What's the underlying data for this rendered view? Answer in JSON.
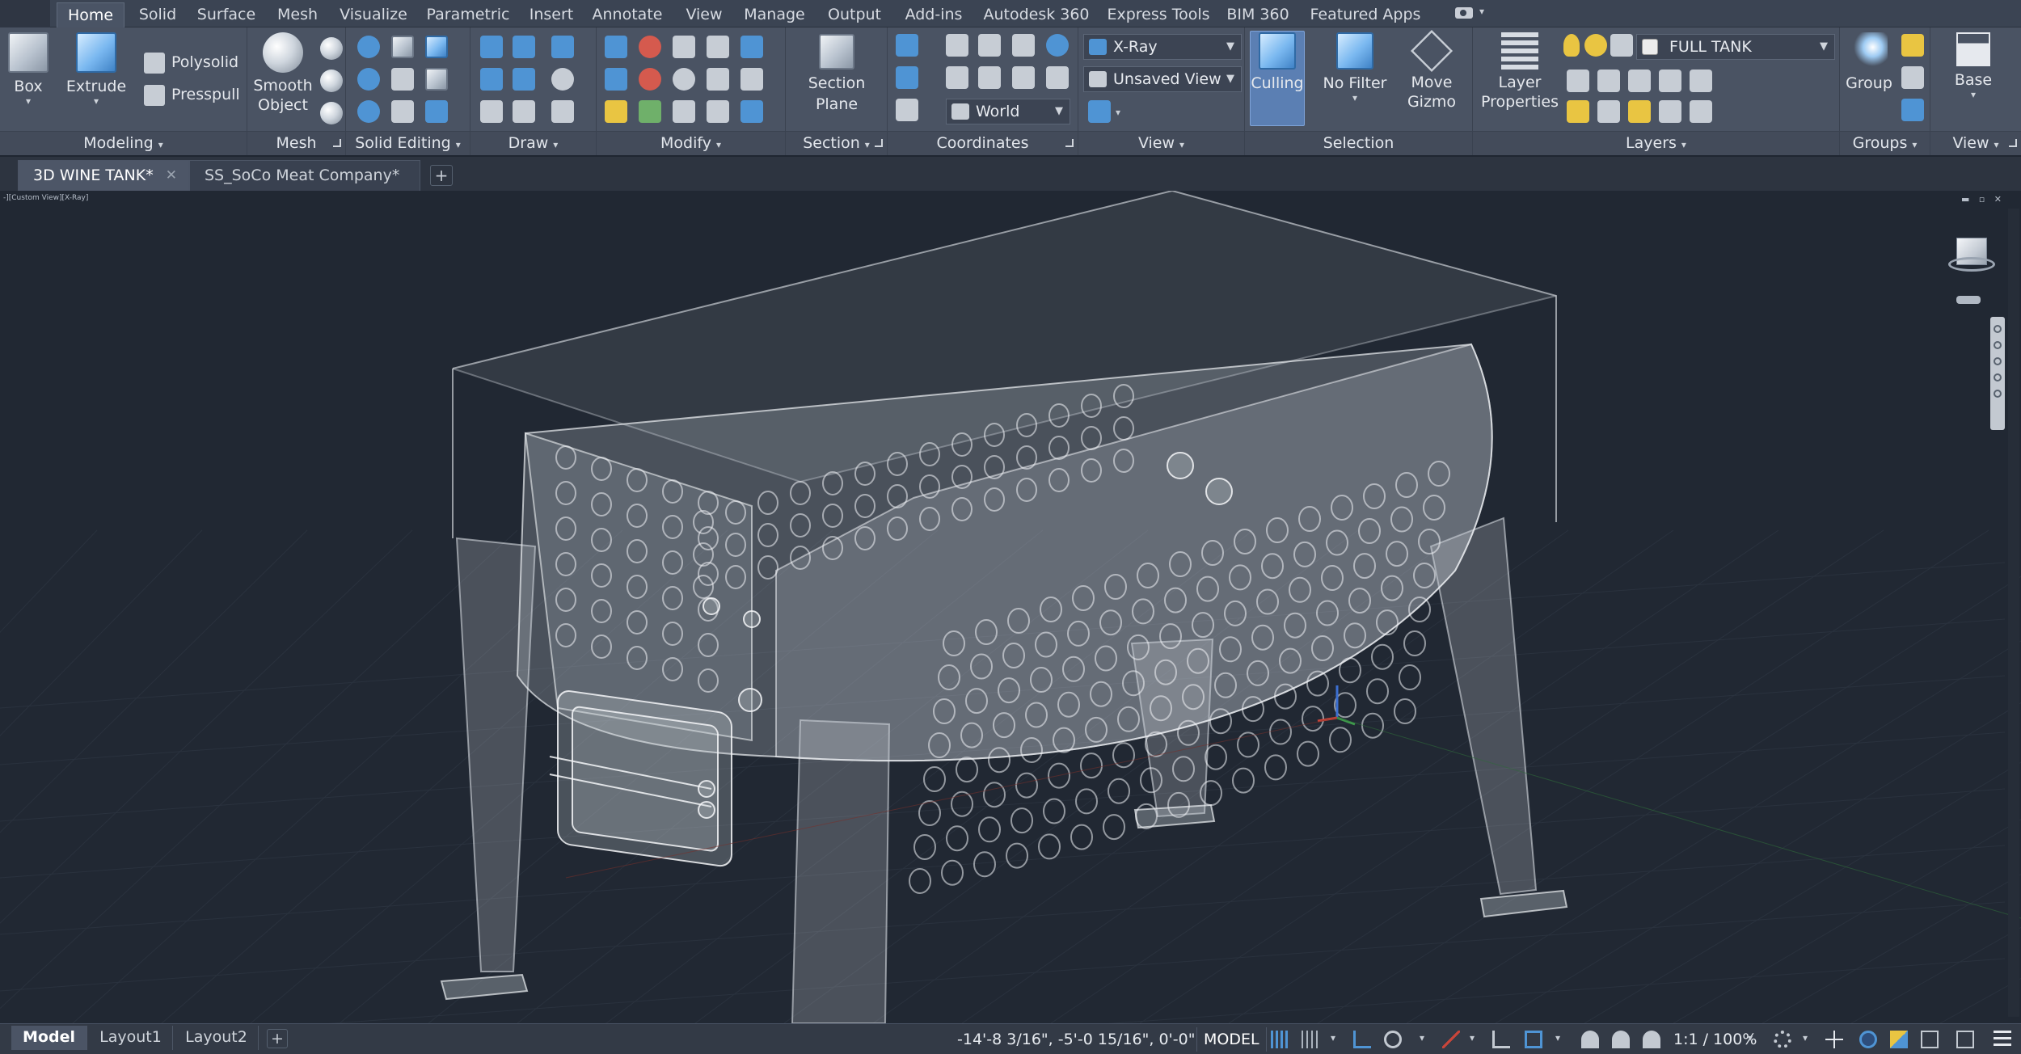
{
  "ribbon_tabs": [
    "Home",
    "Solid",
    "Surface",
    "Mesh",
    "Visualize",
    "Parametric",
    "Insert",
    "Annotate",
    "View",
    "Manage",
    "Output",
    "Add-ins",
    "Autodesk 360",
    "Express Tools",
    "BIM 360",
    "Featured Apps"
  ],
  "active_ribbon_tab": "Home",
  "panels": {
    "modeling": {
      "title": "Modeling",
      "box_label": "Box",
      "extrude_label": "Extrude",
      "polysolid_label": "Polysolid",
      "presspull_label": "Presspull"
    },
    "mesh": {
      "title": "Mesh",
      "smooth_label": "Smooth",
      "smooth_label2": "Object"
    },
    "solid_editing": {
      "title": "Solid Editing"
    },
    "draw": {
      "title": "Draw"
    },
    "modify": {
      "title": "Modify"
    },
    "section": {
      "title": "Section",
      "plane_label": "Section",
      "plane_label2": "Plane"
    },
    "coordinates": {
      "title": "Coordinates",
      "ucs_combo": "World"
    },
    "view": {
      "title": "View",
      "visual_style": "X-Ray",
      "named_view": "Unsaved View"
    },
    "selection": {
      "title": "Selection",
      "culling_label": "Culling",
      "filter_label": "No Filter",
      "gizmo_label": "Move",
      "gizmo_label2": "Gizmo"
    },
    "layers": {
      "title": "Layers",
      "properties_label": "Layer",
      "properties_label2": "Properties",
      "current_layer": "FULL TANK"
    },
    "groups": {
      "title": "Groups",
      "group_label": "Group"
    },
    "view2": {
      "title": "View",
      "base_label": "Base"
    }
  },
  "doc_tabs": [
    {
      "label": "3D WINE TANK*",
      "active": true
    },
    {
      "label": "SS_SoCo Meat Company*",
      "active": false
    }
  ],
  "viewport": {
    "label": "-][Custom View][X-Ray]"
  },
  "layout_tabs": [
    {
      "label": "Model",
      "active": true
    },
    {
      "label": "Layout1",
      "active": false
    },
    {
      "label": "Layout2",
      "active": false
    }
  ],
  "status": {
    "coordinates": "-14'-8 3/16\", -5'-0 15/16\", 0'-0\"",
    "space": "MODEL",
    "annotation_scale": "1:1 / 100%"
  },
  "colors": {
    "ribbon_bg": "#4a5363",
    "viewport_bg": "#212833",
    "tank_fill": "#b9bfc7",
    "tank_edge": "#e6e9ee",
    "axis_x": "#c9453a",
    "axis_y": "#3f9b4c",
    "axis_z": "#3c6fd1"
  }
}
